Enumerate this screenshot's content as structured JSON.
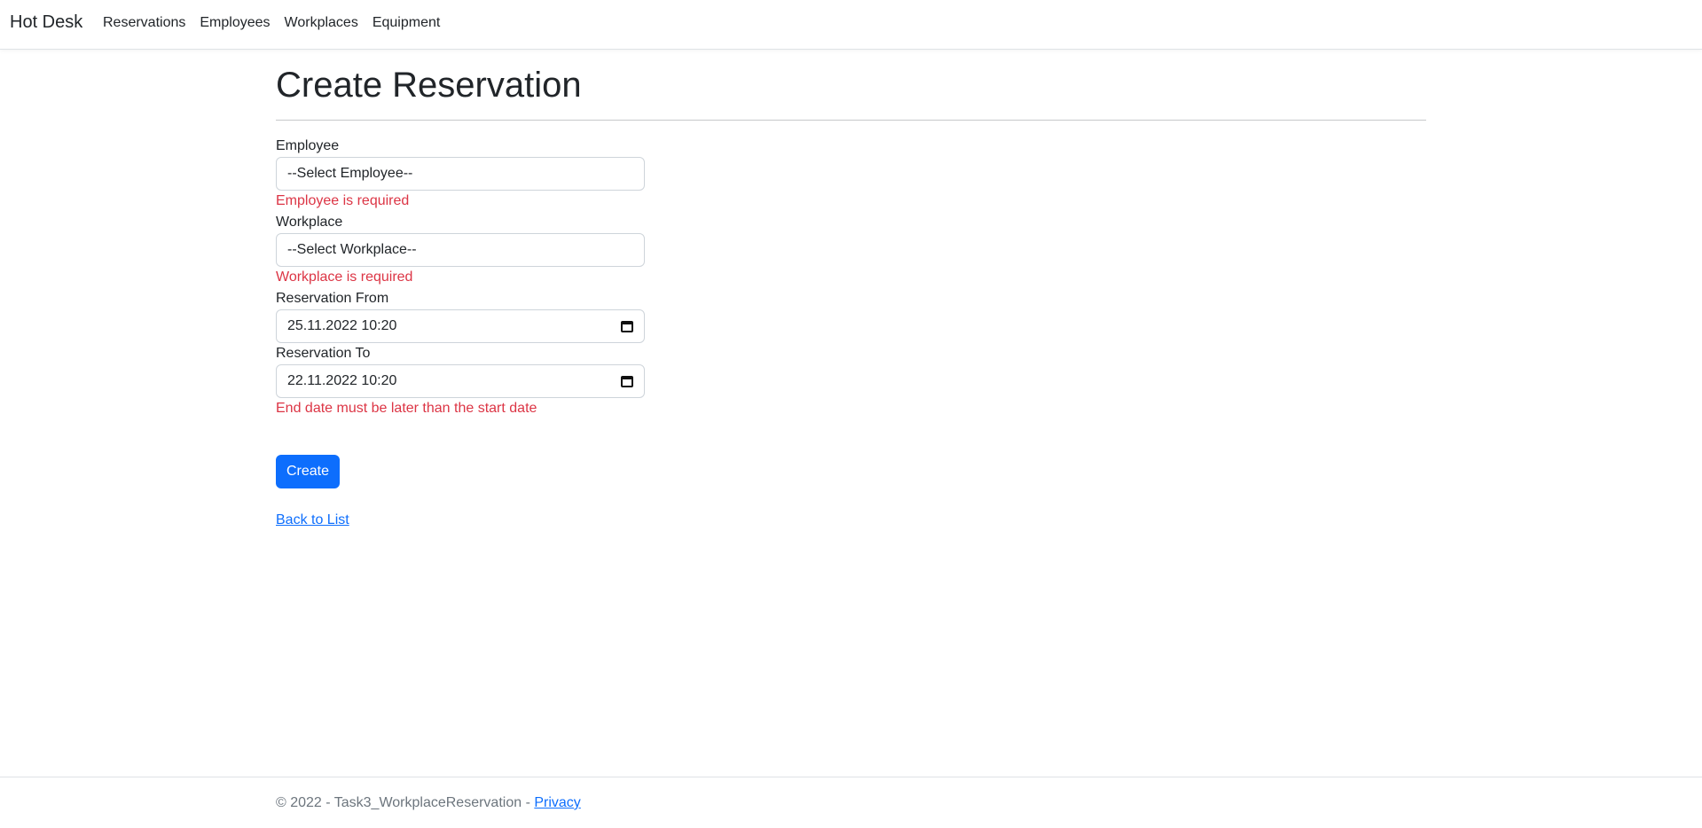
{
  "navbar": {
    "brand": "Hot Desk",
    "links": [
      "Reservations",
      "Employees",
      "Workplaces",
      "Equipment"
    ]
  },
  "page": {
    "title": "Create Reservation"
  },
  "form": {
    "employee": {
      "label": "Employee",
      "value": "--Select Employee--",
      "error": "Employee is required"
    },
    "workplace": {
      "label": "Workplace",
      "value": "--Select Workplace--",
      "error": "Workplace is required"
    },
    "reservation_from": {
      "label": "Reservation From",
      "value": "25.11.2022 10:20"
    },
    "reservation_to": {
      "label": "Reservation To",
      "value": "22.11.2022 10:20",
      "error": "End date must be later than the start date"
    },
    "submit_label": "Create",
    "back_label": "Back to List"
  },
  "footer": {
    "text": "© 2022 - Task3_WorkplaceReservation - ",
    "privacy_label": "Privacy"
  },
  "colors": {
    "primary": "#0d6efd",
    "error": "#dc3545",
    "muted": "#6c757d"
  }
}
